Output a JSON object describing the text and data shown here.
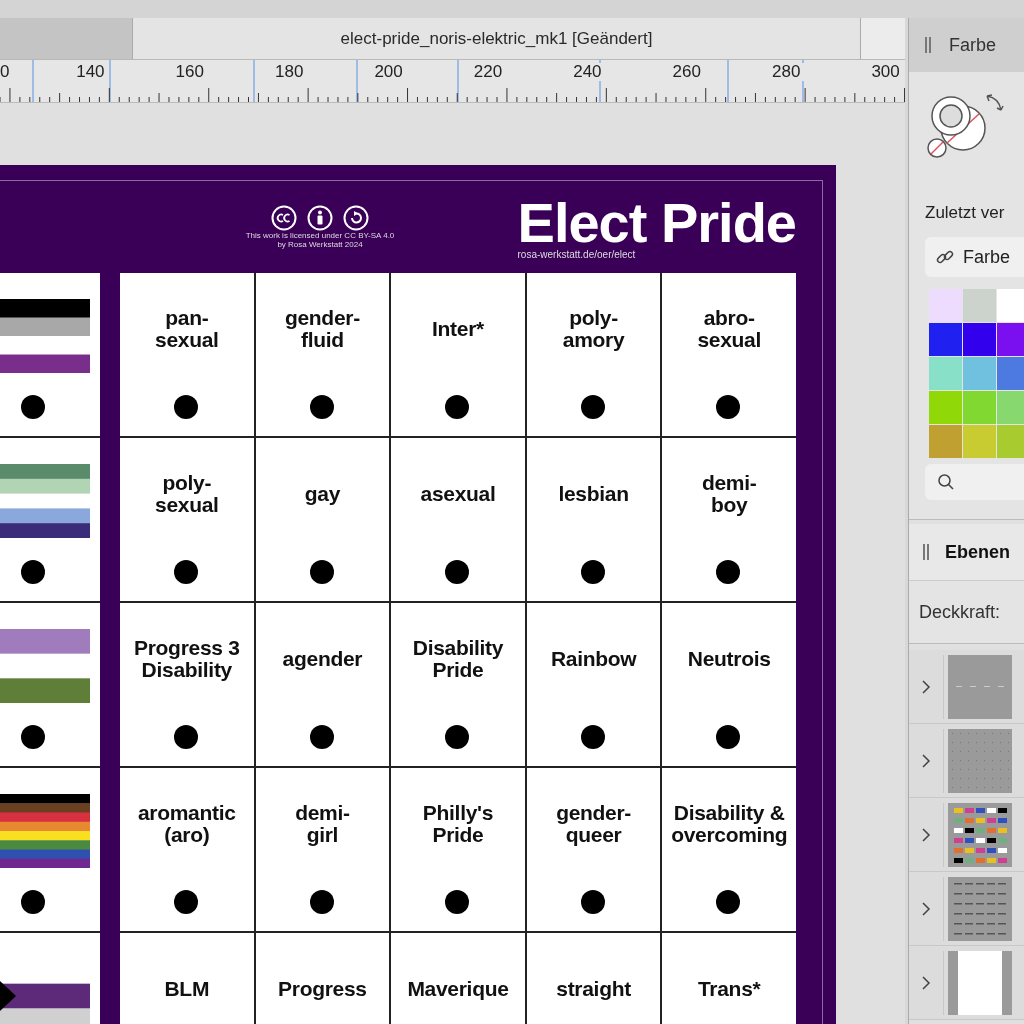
{
  "document_tab": {
    "title": "elect-pride_noris-elektric_mk1 [Geändert]"
  },
  "ruler": {
    "labels": [
      "0",
      "140",
      "160",
      "180",
      "200",
      "220",
      "240",
      "260",
      "280",
      "300"
    ]
  },
  "poster": {
    "title": "Elect Pride",
    "url": "rosa-werkstatt.de/oer/elect",
    "license_lines": [
      "This work is licensed under CC BY-SA 4.0",
      "by Rosa Werkstatt 2024"
    ],
    "flags": [
      {
        "stripes": [
          {
            "color": "#000000"
          },
          {
            "color": "#a8a8a8"
          },
          {
            "color": "#ffffff"
          },
          {
            "color": "#7a2e8c"
          }
        ]
      },
      {
        "stripes": [
          {
            "color": "#5a8c6c"
          },
          {
            "color": "#b0d4b4"
          },
          {
            "color": "#ffffff"
          },
          {
            "color": "#8aa8dc"
          },
          {
            "color": "#3a2c78"
          }
        ]
      },
      {
        "stripes": [
          {
            "color": "#a07cbc"
          },
          {
            "color": "#ffffff"
          },
          {
            "color": "#5f7e38"
          }
        ]
      },
      {
        "stripes": [
          {
            "color": "#000000"
          },
          {
            "color": "#6a4020"
          },
          {
            "color": "#d83040"
          },
          {
            "color": "#e88830"
          },
          {
            "color": "#f8e020"
          },
          {
            "color": "#4a8a40"
          },
          {
            "color": "#3050b0"
          },
          {
            "color": "#702890"
          }
        ]
      },
      {
        "kind": "chevron",
        "stripes": [
          {
            "color": "#ffffff"
          },
          {
            "color": "#5c2a78"
          },
          {
            "color": "#d0d0d0"
          }
        ]
      }
    ],
    "rows": [
      [
        "pan-\nsexual",
        "gender-\nfluid",
        "Inter*",
        "poly-\namory",
        "abro-\nsexual"
      ],
      [
        "poly-\nsexual",
        "gay",
        "asexual",
        "lesbian",
        "demi-\nboy"
      ],
      [
        "Progress 3\nDisability",
        "agender",
        "Disability\nPride",
        "Rainbow",
        "Neutrois"
      ],
      [
        "aromantic\n(aro)",
        "demi-\ngirl",
        "Philly's\nPride",
        "gender-\nqueer",
        "Disability &\novercoming"
      ],
      [
        "BLM",
        "Progress",
        "Maverique",
        "straight",
        "Trans*"
      ]
    ]
  },
  "color_panel": {
    "title": "Farbe",
    "recent_label": "Zuletzt ver",
    "link_button": "Farbe",
    "swatches": [
      {
        "color": "#eedcff"
      },
      {
        "color": "#cbd3cc"
      },
      {
        "color": "#ffffff"
      },
      {
        "color": "#2020f0"
      },
      {
        "color": "#3300ee"
      },
      {
        "color": "#7a10f0"
      },
      {
        "color": "#88e0c8"
      },
      {
        "color": "#70c0e0"
      },
      {
        "color": "#4c7ae0"
      },
      {
        "color": "#90d808"
      },
      {
        "color": "#80d830"
      },
      {
        "color": "#88d870"
      },
      {
        "color": "#c0a030"
      },
      {
        "color": "#c8cc30"
      },
      {
        "color": "#a8cc30"
      }
    ]
  },
  "layers_panel": {
    "title": "Ebenen",
    "opacity_label": "Deckkraft:",
    "layers": [
      {
        "kind": "lines",
        "expanded": false
      },
      {
        "kind": "dots",
        "expanded": false
      },
      {
        "kind": "flags",
        "expanded": false
      },
      {
        "kind": "texts",
        "expanded": false
      },
      {
        "kind": "page",
        "expanded": false
      }
    ]
  }
}
